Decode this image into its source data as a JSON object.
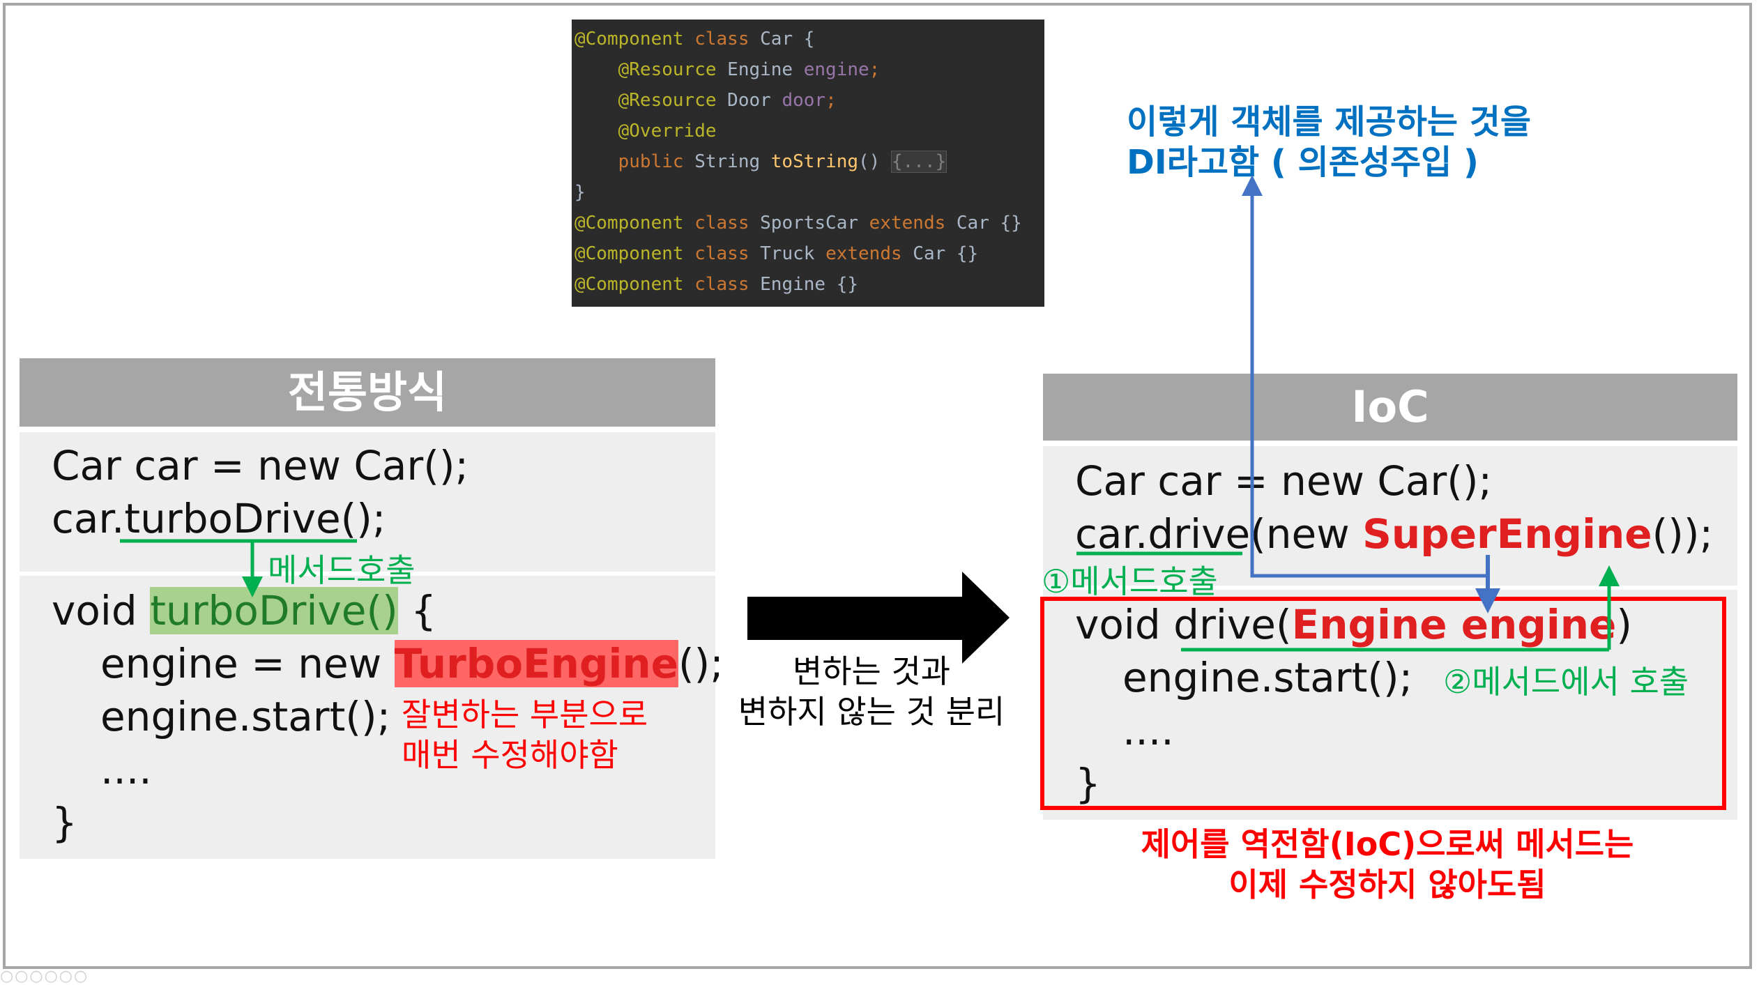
{
  "code_snippet": {
    "lines": [
      {
        "tokens": [
          {
            "t": "@Component",
            "c": "ann"
          },
          {
            "t": " "
          },
          {
            "t": "class",
            "c": "kw"
          },
          {
            "t": " Car {"
          }
        ]
      },
      {
        "tokens": [
          {
            "t": "    "
          },
          {
            "t": "@Resource",
            "c": "ann"
          },
          {
            "t": " Engine "
          },
          {
            "t": "engine",
            "c": "fld"
          },
          {
            "t": ";",
            "c": "kw"
          }
        ]
      },
      {
        "tokens": [
          {
            "t": "    "
          },
          {
            "t": "@Resource",
            "c": "ann"
          },
          {
            "t": " Door "
          },
          {
            "t": "door",
            "c": "fld"
          },
          {
            "t": ";",
            "c": "kw"
          }
        ]
      },
      {
        "tokens": [
          {
            "t": "    "
          },
          {
            "t": "@Override",
            "c": "ann"
          }
        ]
      },
      {
        "tokens": [
          {
            "t": "    "
          },
          {
            "t": "public",
            "c": "kw"
          },
          {
            "t": " String "
          },
          {
            "t": "toString",
            "c": "mth"
          },
          {
            "t": "() "
          },
          {
            "t": "{...}",
            "c": "fold"
          }
        ]
      },
      {
        "tokens": [
          {
            "t": "}"
          }
        ]
      },
      {
        "tokens": [
          {
            "t": "@Component",
            "c": "ann"
          },
          {
            "t": " "
          },
          {
            "t": "class",
            "c": "kw"
          },
          {
            "t": " SportsCar "
          },
          {
            "t": "extends",
            "c": "kw"
          },
          {
            "t": " Car {}"
          }
        ]
      },
      {
        "tokens": [
          {
            "t": "@Component",
            "c": "ann"
          },
          {
            "t": " "
          },
          {
            "t": "class",
            "c": "kw"
          },
          {
            "t": " Truck "
          },
          {
            "t": "extends",
            "c": "kw"
          },
          {
            "t": " Car {}"
          }
        ]
      },
      {
        "tokens": [
          {
            "t": "@Component",
            "c": "ann"
          },
          {
            "t": " "
          },
          {
            "t": "class",
            "c": "kw"
          },
          {
            "t": " Engine {}"
          }
        ]
      }
    ]
  },
  "left_panel": {
    "title": "전통방식",
    "line1": "Car car = new Car();",
    "line2_prefix": "car.",
    "line2_method": "turboDrive",
    "line2_suffix": "();",
    "method_call_label": "메서드호출",
    "void_prefix": "void ",
    "void_method": "turboDrive()",
    "void_suffix": " {",
    "engine_prefix": "engine = new ",
    "engine_class": "TurboEngine",
    "engine_suffix": "();",
    "start_line": "engine.start();",
    "dots": "....",
    "close": "}",
    "note_line1": "잘변하는 부분으로",
    "note_line2": "매번 수정해야함"
  },
  "middle": {
    "caption_line1": "변하는 것과",
    "caption_line2": "변하지 않는 것 분리"
  },
  "right_panel": {
    "title": "IoC",
    "line1": "Car car = new Car();",
    "line2_prefix": "car.drive(new ",
    "line2_class": "SuperEngine",
    "line2_suffix": "());",
    "label_call1": "①메서드호출",
    "void_prefix": "void drive(",
    "void_param": "Engine engine",
    "void_suffix": ")",
    "start_line": "engine.start();",
    "label_call2": "②메서드에서 호출",
    "dots": "....",
    "close": "}",
    "note_line1": "제어를 역전함(IoC)으로써 메서드는",
    "note_line2": "이제 수정하지 않아도됨"
  },
  "di_note": {
    "line1": "이렇게 객체를 제공하는 것을",
    "line2": "DI라고함 ( 의존성주입 )"
  },
  "colors": {
    "header_gray": "#a6a6a6",
    "band_gray": "#eeeeee",
    "green": "#00b050",
    "red": "#ff0000",
    "blue": "#4472c4",
    "di_blue": "#0070c0"
  }
}
